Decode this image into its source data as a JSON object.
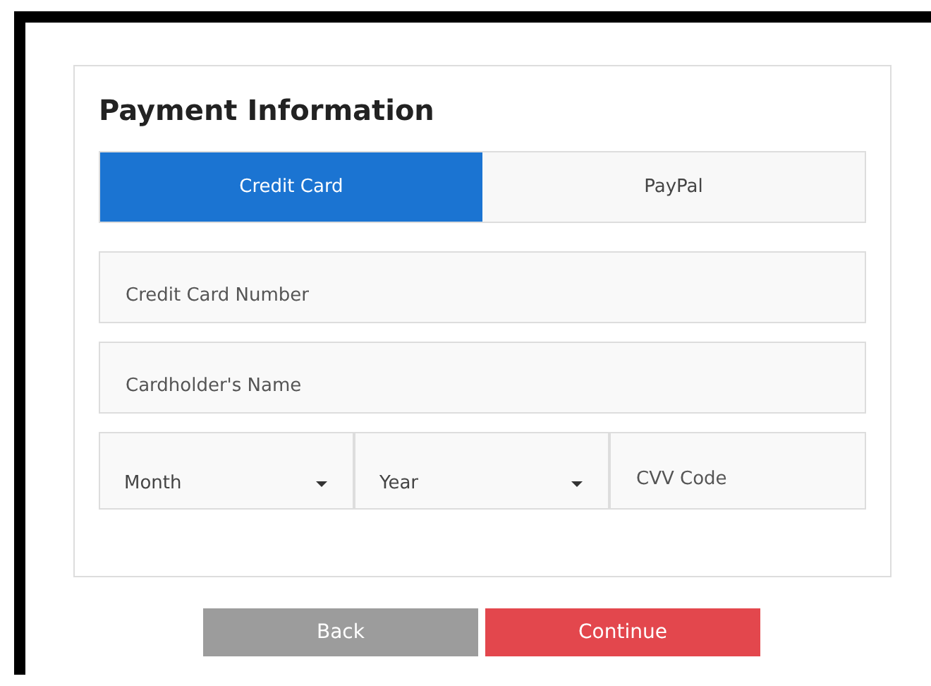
{
  "title": "Payment Information",
  "tabs": [
    {
      "label": "Credit Card",
      "selected": true
    },
    {
      "label": "PayPal",
      "selected": false
    }
  ],
  "fields": [
    {
      "kind": "text",
      "placeholder": "Credit Card Number"
    },
    {
      "kind": "text",
      "placeholder": "Cardholder's Name"
    }
  ],
  "row_fields": [
    {
      "kind": "select",
      "placeholder": "Month"
    },
    {
      "kind": "select",
      "placeholder": "Year"
    },
    {
      "kind": "text",
      "placeholder": "CVV Code"
    }
  ],
  "buttons": [
    {
      "label": "Back",
      "kind": "secondary",
      "disabled": true
    },
    {
      "label": "Continue",
      "kind": "primary",
      "disabled": false
    }
  ]
}
